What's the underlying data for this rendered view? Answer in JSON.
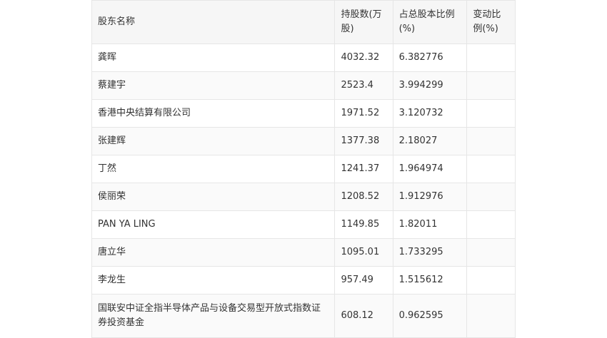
{
  "table": {
    "headers": [
      "股东名称",
      "持股数(万股)",
      "占总股本比例(%)",
      "变动比例(%)"
    ],
    "rows": [
      {
        "name": "龚晖",
        "shares": "4032.32",
        "ratio": "6.382776",
        "change": ""
      },
      {
        "name": "蔡建宇",
        "shares": "2523.4",
        "ratio": "3.994299",
        "change": ""
      },
      {
        "name": "香港中央结算有限公司",
        "shares": "1971.52",
        "ratio": "3.120732",
        "change": ""
      },
      {
        "name": "张建辉",
        "shares": "1377.38",
        "ratio": "2.18027",
        "change": ""
      },
      {
        "name": "丁然",
        "shares": "1241.37",
        "ratio": "1.964974",
        "change": ""
      },
      {
        "name": "侯丽荣",
        "shares": "1208.52",
        "ratio": "1.912976",
        "change": ""
      },
      {
        "name": "PAN YA LING",
        "shares": "1149.85",
        "ratio": "1.82011",
        "change": ""
      },
      {
        "name": "唐立华",
        "shares": "1095.01",
        "ratio": "1.733295",
        "change": ""
      },
      {
        "name": "李龙生",
        "shares": "957.49",
        "ratio": "1.515612",
        "change": ""
      },
      {
        "name": "国联安中证全指半导体产品与设备交易型开放式指数证券投资基金",
        "shares": "608.12",
        "ratio": "0.962595",
        "change": ""
      }
    ]
  }
}
